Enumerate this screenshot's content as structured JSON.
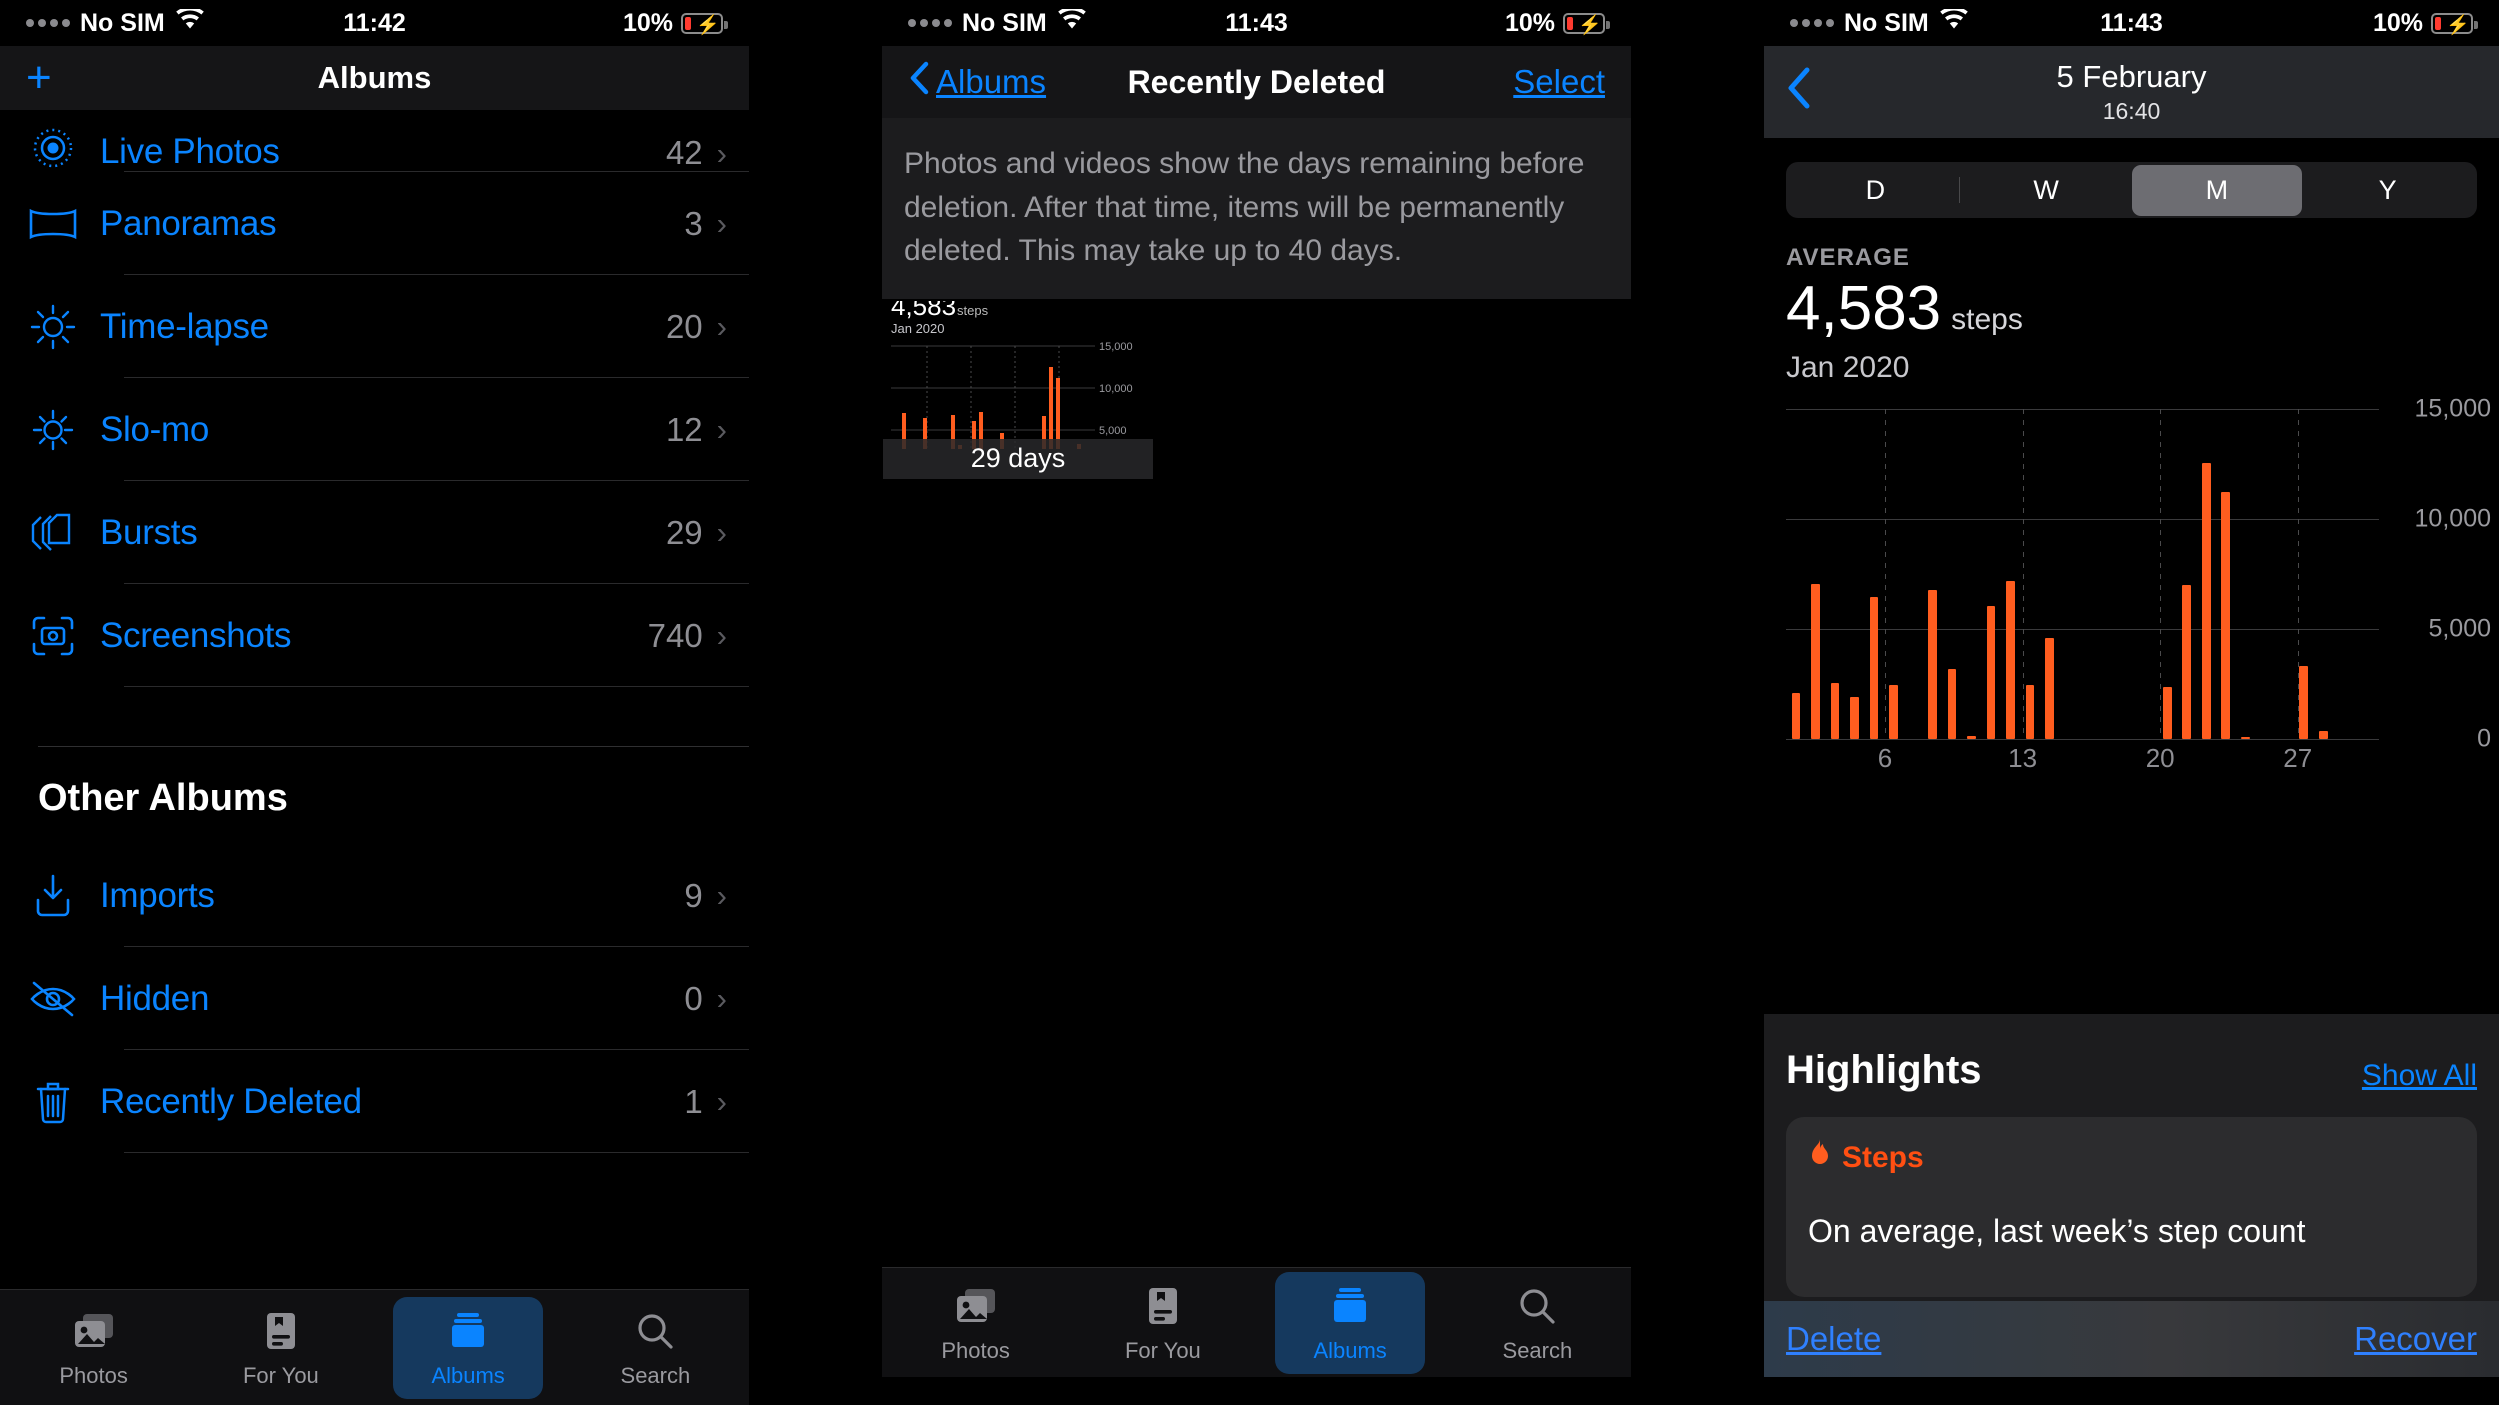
{
  "statusbar": {
    "carrier": "No SIM",
    "wifi_icon": "wifi-icon",
    "time_p1": "11:42",
    "time_p2": "11:43",
    "time_p3": "11:43",
    "battery_percent": "10%",
    "battery_icon": "battery-charging-icon"
  },
  "panel1": {
    "name": "photos-albums",
    "add_button": "+",
    "title": "Albums",
    "albums": [
      {
        "icon": "live-photos-icon",
        "label": "Live Photos",
        "count": "42",
        "chevron": "›"
      },
      {
        "icon": "panorama-icon",
        "label": "Panoramas",
        "count": "3",
        "chevron": "›"
      },
      {
        "icon": "time-lapse-icon",
        "label": "Time-lapse",
        "count": "20",
        "chevron": "›"
      },
      {
        "icon": "slo-mo-icon",
        "label": "Slo-mo",
        "count": "12",
        "chevron": "›"
      },
      {
        "icon": "bursts-icon",
        "label": "Bursts",
        "count": "29",
        "chevron": "›"
      },
      {
        "icon": "screenshots-icon",
        "label": "Screenshots",
        "count": "740",
        "chevron": "›"
      }
    ],
    "other_albums_header": "Other Albums",
    "other_albums": [
      {
        "icon": "import-icon",
        "label": "Imports",
        "count": "9",
        "chevron": "›"
      },
      {
        "icon": "hidden-eye-icon",
        "label": "Hidden",
        "count": "0",
        "chevron": "›"
      },
      {
        "icon": "trash-icon",
        "label": "Recently Deleted",
        "count": "1",
        "chevron": "›"
      }
    ],
    "tabs": [
      {
        "icon": "photos-icon",
        "label": "Photos",
        "active": false
      },
      {
        "icon": "for-you-icon",
        "label": "For You",
        "active": false
      },
      {
        "icon": "albums-icon",
        "label": "Albums",
        "active": true
      },
      {
        "icon": "search-icon",
        "label": "Search",
        "active": false
      }
    ]
  },
  "panel2": {
    "name": "recently-deleted",
    "back_label": "Albums",
    "title": "Recently Deleted",
    "select_label": "Select",
    "note": "Photos and videos show the days remaining before deletion. After that time, items will be permanently deleted. This may take up to 40 days.",
    "thumbnail": {
      "value": "4,583",
      "unit": "steps",
      "period": "Jan 2020",
      "days_badge": "29 days"
    },
    "tabs": [
      {
        "icon": "photos-icon",
        "label": "Photos",
        "active": false
      },
      {
        "icon": "for-you-icon",
        "label": "For You",
        "active": false
      },
      {
        "icon": "albums-icon",
        "label": "Albums",
        "active": true
      },
      {
        "icon": "search-icon",
        "label": "Search",
        "active": false
      }
    ]
  },
  "panel3": {
    "name": "health-steps-detail",
    "back_icon": "chevron-left-icon",
    "date": "5 February",
    "time": "16:40",
    "segments": [
      {
        "label": "D",
        "selected": false
      },
      {
        "label": "W",
        "selected": false
      },
      {
        "label": "M",
        "selected": true
      },
      {
        "label": "Y",
        "selected": false
      }
    ],
    "average_label": "AVERAGE",
    "average_value": "4,583",
    "average_unit": "steps",
    "average_period": "Jan 2020",
    "highlights": {
      "title": "Highlights",
      "show_all": "Show All",
      "card_icon": "flame-icon",
      "card_category": "Steps",
      "card_text": "On average, last week’s step count"
    },
    "actions": {
      "delete": "Delete",
      "recover": "Recover"
    }
  },
  "chart_data": {
    "type": "bar",
    "title": "Steps",
    "subtitle": "Jan 2020",
    "xlabel": "",
    "ylabel": "steps",
    "ylim": [
      0,
      15000
    ],
    "yticks": [
      0,
      5000,
      10000,
      15000
    ],
    "ytick_labels": [
      "0",
      "5,000",
      "10,000",
      "15,000"
    ],
    "xticks": [
      6,
      13,
      20,
      27
    ],
    "xtick_labels": [
      "6",
      "13",
      "20",
      "27"
    ],
    "grid": true,
    "legend": false,
    "bar_color": "#ff5d1f",
    "average": 4583,
    "x": [
      1,
      2,
      3,
      4,
      5,
      6,
      7,
      8,
      9,
      10,
      11,
      12,
      13,
      14,
      15,
      16,
      17,
      18,
      19,
      20,
      21,
      22,
      23,
      24,
      25,
      26,
      27,
      28,
      29,
      30,
      31
    ],
    "values": [
      2100,
      7050,
      2550,
      1900,
      6450,
      0,
      2450,
      0,
      6750,
      3200,
      120,
      6050,
      7200,
      0,
      2450,
      4600,
      0,
      0,
      0,
      0,
      0,
      2350,
      7000,
      12550,
      11200,
      80,
      0,
      0,
      3300,
      350,
      0
    ],
    "categories": [
      "1",
      "2",
      "3",
      "4",
      "5",
      "6",
      "7",
      "8",
      "9",
      "10",
      "11",
      "12",
      "13",
      "14",
      "15",
      "16",
      "17",
      "18",
      "19",
      "20",
      "21",
      "22",
      "23",
      "24",
      "25",
      "26",
      "27",
      "28",
      "29",
      "30",
      "31"
    ]
  }
}
